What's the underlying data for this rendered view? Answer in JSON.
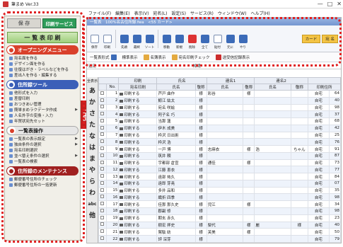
{
  "window": {
    "title": "筆まめ Ver.33",
    "buttons": [
      "—",
      "□",
      "✕"
    ]
  },
  "menubar": [
    "ファイル(F)",
    "編集(E)",
    "表示(V)",
    "宛名(L)",
    "設定(S)",
    "サービス(R)",
    "ウィンドウ(W)",
    "ヘルプ(H)"
  ],
  "sidebar": {
    "save_label": "保 存",
    "print_service_label": "印刷サービス",
    "list_print_label": "一 覧 表 印 刷",
    "sections": [
      {
        "title": "オープニングメニュー",
        "style": "red",
        "items": [
          "宛名面を作る",
          "デザイン面を作る",
          "往復はがき・ラベルなどを作る",
          "差出人を作る・編集する"
        ]
      },
      {
        "title": "住所録ツール",
        "style": "blue",
        "items": [
          "他形式を入力",
          "差替印刷",
          "おつきあい管理",
          "簡単まめラクデータ作成",
          "人名外字の変換・入力",
          "年賀状宛先セット"
        ]
      },
      {
        "title": "一覧表操作",
        "style": "gray",
        "items": [
          "一覧表の表示設定",
          "独自条件の選択",
          "宛名印刷選択",
          "並べ替え条件の選択",
          "一覧表の検索"
        ]
      },
      {
        "title": "住所録のメンテナンス",
        "style": "dark",
        "items": [
          "郵便番号住所のチェック",
          "郵便番号住所の一括更新"
        ]
      }
    ],
    "list_tab_label": "一覧表"
  },
  "main": {
    "title": "一覧表　100%名古住所録.fwa　<55 カード>",
    "toolbar": [
      {
        "label": "保存",
        "color": "white"
      },
      {
        "label": "印刷",
        "color": "white"
      },
      {
        "label": "先頭",
        "color": "blue"
      },
      {
        "label": "最終",
        "color": "blue"
      },
      {
        "label": "ソート",
        "color": "blue"
      },
      {
        "label": "移動",
        "color": "blue"
      },
      {
        "label": "新規",
        "color": "blue"
      },
      {
        "label": "削除",
        "color": "red"
      },
      {
        "label": "全て",
        "color": "blue"
      },
      {
        "label": "貼付",
        "color": "white"
      },
      {
        "label": "元に",
        "color": "blue"
      },
      {
        "label": "やり",
        "color": "blue"
      }
    ],
    "toolbar_right": [
      "カード",
      "宛 名"
    ],
    "options": [
      "一覧表形式",
      "標準表示",
      "名簿表示",
      "宛名印刷チェック",
      "送受信記録表示"
    ],
    "filter": {
      "left": "送足",
      "right": "知達"
    },
    "kana_index": {
      "top": "全表示",
      "letters": [
        "あ",
        "か",
        "さ",
        "た",
        "な",
        "は",
        "ま",
        "や",
        "ら",
        "わ"
      ],
      "abc": "abc",
      "other": "他"
    },
    "columns": {
      "group1": "印刷",
      "group2": "氏名",
      "group3": "連名1",
      "group4": "連名2",
      "no": "No.",
      "print_label": "宛名印刷",
      "name": "氏名",
      "honorific": "敬称",
      "ren1": "氏名",
      "ren1_h": "敬称",
      "ren2": "氏名",
      "ren2_h": "敬称",
      "print_set": "印刷住所"
    },
    "rows": [
      {
        "no": "1",
        "print": "印刷する",
        "name": "芦戸 曲作",
        "h": "様",
        "r1": "彩谷",
        "r1h": "様",
        "r2": "",
        "r2h": "",
        "dest": "自宅",
        "n": "64"
      },
      {
        "no": "2",
        "print": "印刷する",
        "name": "鯨江 紘太",
        "h": "様",
        "r1": "",
        "r1h": "",
        "r2": "",
        "r2h": "",
        "dest": "自宅",
        "n": "40"
      },
      {
        "no": "3",
        "print": "印刷する",
        "name": "宛名 咲絵",
        "h": "様",
        "r1": "",
        "r1h": "",
        "r2": "",
        "r2h": "",
        "dest": "自宅",
        "n": "98"
      },
      {
        "no": "4",
        "print": "印刷する",
        "name": "阿子名 巧",
        "h": "様",
        "r1": "",
        "r1h": "",
        "r2": "",
        "r2h": "",
        "dest": "自宅",
        "n": "37"
      },
      {
        "no": "5",
        "print": "印刷する",
        "name": "当那 蓮",
        "h": "様",
        "r1": "",
        "r1h": "",
        "r2": "",
        "r2h": "",
        "dest": "自宅",
        "n": "68"
      },
      {
        "no": "6",
        "print": "印刷する",
        "name": "伊木 成美",
        "h": "様",
        "r1": "",
        "r1h": "",
        "r2": "",
        "r2h": "",
        "dest": "自宅",
        "n": "42"
      },
      {
        "no": "7",
        "print": "印刷する",
        "name": "枠沢 日出術",
        "h": "様",
        "r1": "",
        "r1h": "",
        "r2": "",
        "r2h": "",
        "dest": "自宅",
        "n": "25"
      },
      {
        "no": "8",
        "print": "印刷する",
        "name": "枠沢 浩",
        "h": "様",
        "r1": "",
        "r1h": "",
        "r2": "",
        "r2h": "",
        "dest": "自宅",
        "n": "76"
      },
      {
        "no": "9",
        "print": "印刷する",
        "name": "一戸 博",
        "h": "様",
        "r1": "志麻衣",
        "r1h": "様",
        "r2": "浩",
        "r2h": "ちゃん",
        "dest": "自宅",
        "n": "91"
      },
      {
        "no": "10",
        "print": "印刷する",
        "name": "筑井 頼",
        "h": "様",
        "r1": "",
        "r1h": "",
        "r2": "",
        "r2h": "",
        "dest": "自宅",
        "n": "87"
      },
      {
        "no": "11",
        "print": "印刷する",
        "name": "宇都部 倉宣",
        "h": "様",
        "r1": "通佳",
        "r1h": "様",
        "r2": "",
        "r2h": "",
        "dest": "自宅",
        "n": "73"
      },
      {
        "no": "12",
        "print": "印刷する",
        "name": "江藤 恵衣",
        "h": "様",
        "r1": "",
        "r1h": "",
        "r2": "",
        "r2h": "",
        "dest": "自宅",
        "n": "77"
      },
      {
        "no": "13",
        "print": "印刷する",
        "name": "遠部 祐久",
        "h": "様",
        "r1": "",
        "r1h": "",
        "r2": "",
        "r2h": "",
        "dest": "自宅",
        "n": "84"
      },
      {
        "no": "14",
        "print": "印刷する",
        "name": "遠郎 芽尭",
        "h": "様",
        "r1": "",
        "r1h": "",
        "r2": "",
        "r2h": "",
        "dest": "自宅",
        "n": "07"
      },
      {
        "no": "15",
        "print": "印刷する",
        "name": "多井 品和",
        "h": "様",
        "r1": "",
        "r1h": "",
        "r2": "",
        "r2h": "",
        "dest": "自宅",
        "n": "35"
      },
      {
        "no": "16",
        "print": "印刷する",
        "name": "織折 四季",
        "h": "様",
        "r1": "",
        "r1h": "",
        "r2": "",
        "r2h": "",
        "dest": "自宅",
        "n": "98"
      },
      {
        "no": "17",
        "print": "印刷する",
        "name": "佳那 那久史",
        "h": "様",
        "r1": "児江",
        "r1h": "様",
        "r2": "",
        "r2h": "",
        "dest": "自宅",
        "n": "34"
      },
      {
        "no": "18",
        "print": "印刷する",
        "name": "郡副 修",
        "h": "様",
        "r1": "",
        "r1h": "",
        "r2": "",
        "r2h": "",
        "dest": "自宅",
        "n": "98"
      },
      {
        "no": "19",
        "print": "印刷する",
        "name": "期玄 赤久",
        "h": "様",
        "r1": "",
        "r1h": "",
        "r2": "",
        "r2h": "",
        "dest": "自宅",
        "n": "23"
      },
      {
        "no": "20",
        "print": "印刷する",
        "name": "樹宏 拝史",
        "h": "様",
        "r1": "梨代",
        "r1h": "様",
        "r2": "麗",
        "r2h": "様",
        "dest": "自宅",
        "n": "40"
      },
      {
        "no": "21",
        "print": "印刷する",
        "name": "鷲駄 紡",
        "h": "様",
        "r1": "芙美",
        "r1h": "様",
        "r2": "",
        "r2h": "",
        "dest": "自宅",
        "n": "50"
      },
      {
        "no": "22",
        "print": "印刷する",
        "name": "評 深芽",
        "h": "様",
        "r1": "",
        "r1h": "",
        "r2": "",
        "r2h": "",
        "dest": "自宅",
        "n": "79"
      }
    ]
  },
  "colors": {
    "accent_red": "#e02020",
    "print_service_green": "#2f9d5a",
    "section_red": "#d9402b",
    "section_blue": "#3b5fb8"
  }
}
